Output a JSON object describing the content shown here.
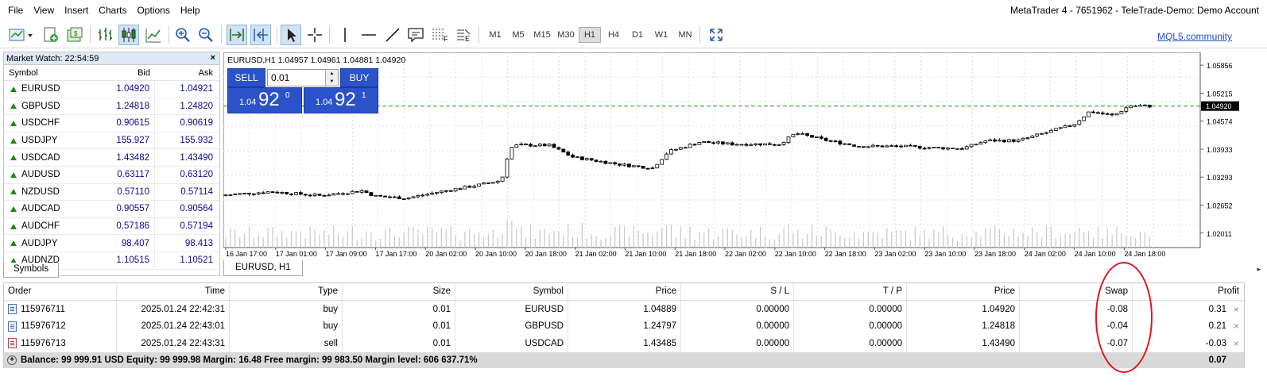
{
  "menu": [
    "File",
    "View",
    "Insert",
    "Charts",
    "Options",
    "Help"
  ],
  "window_title": "MetaTrader 4 - 7651962 - TeleTrade-Demo: Demo Account",
  "toolbar": {
    "timeframes": [
      "M1",
      "M5",
      "M15",
      "M30",
      "H1",
      "H4",
      "D1",
      "W1",
      "MN"
    ],
    "active_timeframe": "H1",
    "mql_link": "MQL5.community"
  },
  "market_watch": {
    "title": "Market Watch: 22:54:59",
    "close": "×",
    "columns": {
      "symbol": "Symbol",
      "bid": "Bid",
      "ask": "Ask"
    },
    "rows": [
      {
        "symbol": "EURUSD",
        "bid": "1.04920",
        "ask": "1.04921"
      },
      {
        "symbol": "GBPUSD",
        "bid": "1.24818",
        "ask": "1.24820"
      },
      {
        "symbol": "USDCHF",
        "bid": "0.90615",
        "ask": "0.90619"
      },
      {
        "symbol": "USDJPY",
        "bid": "155.927",
        "ask": "155.932"
      },
      {
        "symbol": "USDCAD",
        "bid": "1.43482",
        "ask": "1.43490"
      },
      {
        "symbol": "AUDUSD",
        "bid": "0.63117",
        "ask": "0.63120"
      },
      {
        "symbol": "NZDUSD",
        "bid": "0.57110",
        "ask": "0.57114"
      },
      {
        "symbol": "AUDCAD",
        "bid": "0.90557",
        "ask": "0.90564"
      },
      {
        "symbol": "AUDCHF",
        "bid": "0.57186",
        "ask": "0.57194"
      },
      {
        "symbol": "AUDJPY",
        "bid": "98.407",
        "ask": "98.413"
      },
      {
        "symbol": "AUDNZD",
        "bid": "1.10515",
        "ask": "1.10521"
      }
    ],
    "tab": "Symbols"
  },
  "chart": {
    "header": "EURUSD,H1  1.04957 1.04961 1.04881 1.04920",
    "tab": "EURUSD, H1",
    "current_price": "1.04920",
    "y_ticks": [
      "1.05856",
      "1.05215",
      "1.04574",
      "1.03933",
      "1.03293",
      "1.02652",
      "1.02011"
    ],
    "x_ticks": [
      "16 Jan 17:00",
      "17 Jan 01:00",
      "17 Jan 09:00",
      "17 Jan 17:00",
      "20 Jan 02:00",
      "20 Jan 10:00",
      "20 Jan 18:00",
      "21 Jan 02:00",
      "21 Jan 10:00",
      "21 Jan 18:00",
      "22 Jan 02:00",
      "22 Jan 10:00",
      "22 Jan 18:00",
      "23 Jan 02:00",
      "23 Jan 10:00",
      "23 Jan 18:00",
      "24 Jan 02:00",
      "24 Jan 10:00",
      "24 Jan 18:00"
    ]
  },
  "one_click": {
    "sell_label": "SELL",
    "buy_label": "BUY",
    "volume": "0.01",
    "sell_small": "1.04",
    "sell_big": "92",
    "sell_sup": "0",
    "buy_small": "1.04",
    "buy_big": "92",
    "buy_sup": "1"
  },
  "orders": {
    "columns": {
      "order": "Order",
      "time": "Time",
      "type": "Type",
      "size": "Size",
      "symbol": "Symbol",
      "price": "Price",
      "sl": "S / L",
      "tp": "T / P",
      "cprice": "Price",
      "swap": "Swap",
      "profit": "Profit"
    },
    "rows": [
      {
        "order": "115976711",
        "time": "2025.01.24 22:42:31",
        "type": "buy",
        "size": "0.01",
        "symbol": "EURUSD",
        "price": "1.04889",
        "sl": "0.00000",
        "tp": "0.00000",
        "cprice": "1.04920",
        "swap": "-0.08",
        "profit": "0.31"
      },
      {
        "order": "115976712",
        "time": "2025.01.24 22:43:01",
        "type": "buy",
        "size": "0.01",
        "symbol": "GBPUSD",
        "price": "1.24797",
        "sl": "0.00000",
        "tp": "0.00000",
        "cprice": "1.24818",
        "swap": "-0.04",
        "profit": "0.21"
      },
      {
        "order": "115976713",
        "time": "2025.01.24 22:43:31",
        "type": "sell",
        "size": "0.01",
        "symbol": "USDCAD",
        "price": "1.43485",
        "sl": "0.00000",
        "tp": "0.00000",
        "cprice": "1.43490",
        "swap": "-0.07",
        "profit": "-0.03"
      }
    ],
    "close_glyph": "×",
    "balance_line": "Balance: 99 999.91 USD  Equity: 99 999.98  Margin: 16.48  Free margin: 99 983.50  Margin level: 606 637.71%",
    "total_profit": "0.07"
  },
  "colors": {
    "accent": "#2b52c8",
    "highlight_oval": "#e0141e",
    "up_arrow": "#1a8a1a",
    "ask_line": "#1a9a1a"
  }
}
